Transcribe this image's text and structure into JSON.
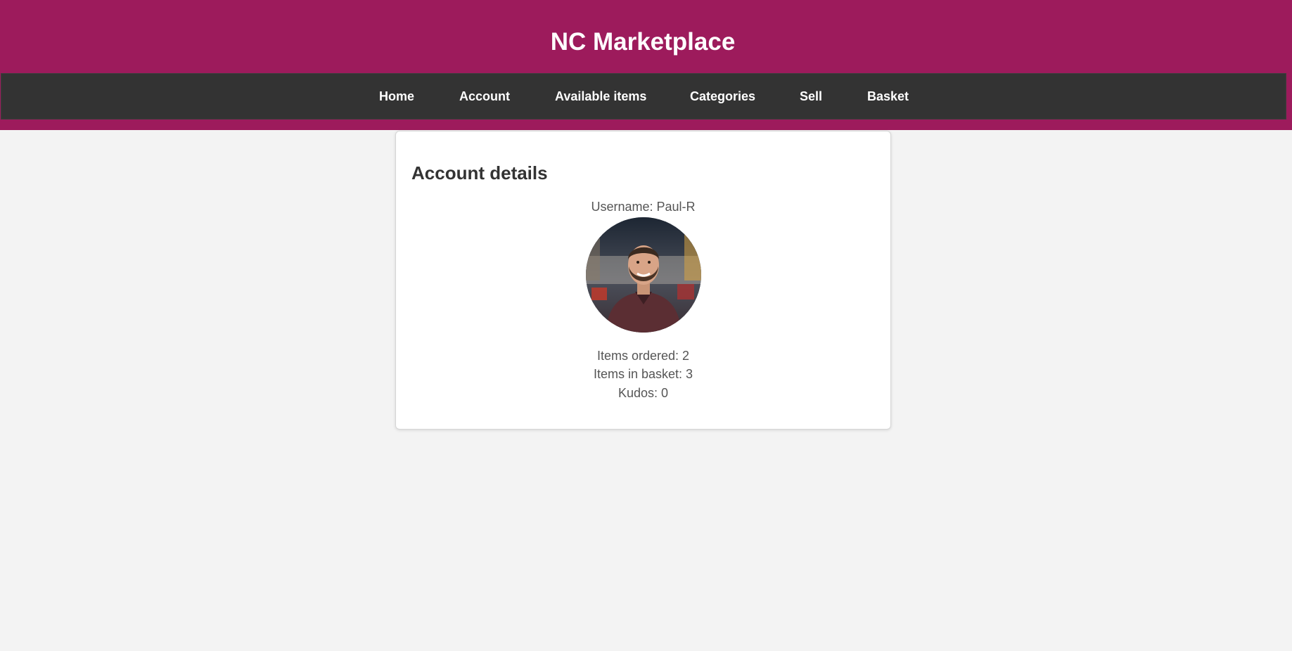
{
  "header": {
    "title": "NC Marketplace"
  },
  "nav": {
    "items": [
      {
        "label": "Home"
      },
      {
        "label": "Account"
      },
      {
        "label": "Available items"
      },
      {
        "label": "Categories"
      },
      {
        "label": "Sell"
      },
      {
        "label": "Basket"
      }
    ]
  },
  "account": {
    "heading": "Account details",
    "username": "Username: Paul-R",
    "avatar_icon": "user-avatar-photo",
    "items_ordered": "Items ordered: 2",
    "items_in_basket": "Items in basket: 3",
    "kudos": "Kudos: 0"
  },
  "colors": {
    "header_bg": "#9d1b5c",
    "nav_bg": "#333333",
    "page_bg": "#f3f3f3",
    "card_bg": "#ffffff"
  }
}
